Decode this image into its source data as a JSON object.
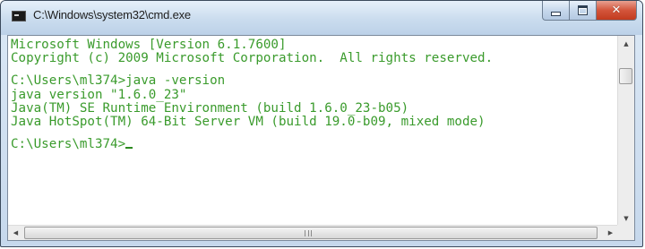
{
  "window": {
    "title": "C:\\Windows\\system32\\cmd.exe",
    "icon": "console-icon"
  },
  "caption_buttons": {
    "minimize": "minimize-icon",
    "maximize": "maximize-icon",
    "close": "close-icon"
  },
  "console": {
    "text_color": "#3a9b2c",
    "background": "#ffffff",
    "lines": [
      "Microsoft Windows [Version 6.1.7600]",
      "Copyright (c) 2009 Microsoft Corporation.  All rights reserved.",
      "",
      "C:\\Users\\ml374>java -version",
      "java version \"1.6.0_23\"",
      "Java(TM) SE Runtime Environment (build 1.6.0_23-b05)",
      "Java HotSpot(TM) 64-Bit Server VM (build 19.0-b09, mixed mode)",
      "",
      "C:\\Users\\ml374>"
    ]
  },
  "scrollbars": {
    "up_arrow": "▲",
    "down_arrow": "▼",
    "left_arrow": "◀",
    "right_arrow": "▶"
  }
}
